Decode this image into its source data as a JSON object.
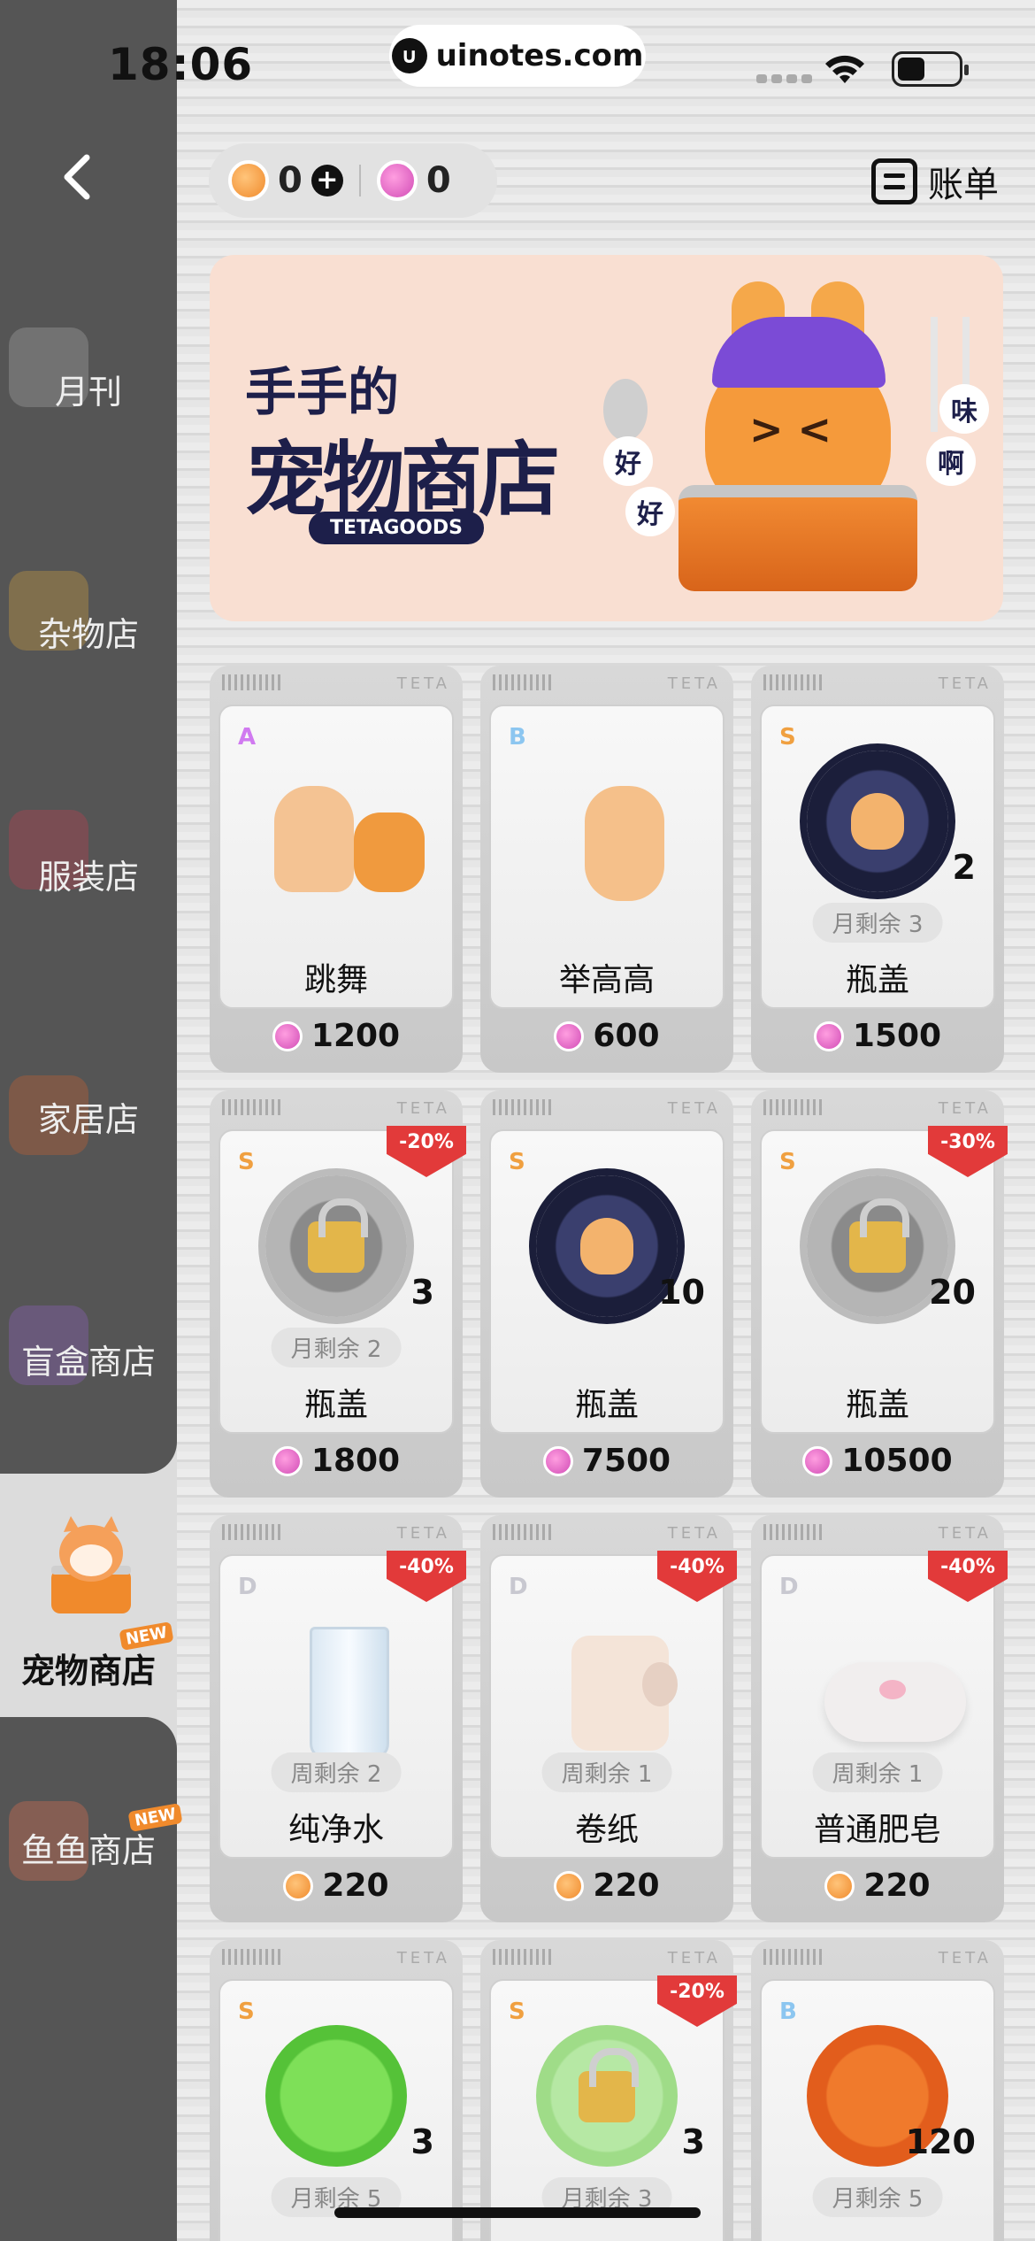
{
  "status_bar": {
    "time": "18:06",
    "url": "uinotes.com"
  },
  "header": {
    "coins": "0",
    "gems": "0",
    "bill_label": "账单"
  },
  "banner": {
    "title_line1": "手手的",
    "title_line2": "宠物商店",
    "brand": "TETAGOODS",
    "bubble_left_1": "好",
    "bubble_left_2": "好",
    "bubble_right_1": "味",
    "bubble_right_2": "啊"
  },
  "sidebar": {
    "items": [
      {
        "label": "月刊"
      },
      {
        "label": "杂物店"
      },
      {
        "label": "服装店"
      },
      {
        "label": "家居店"
      },
      {
        "label": "盲盒商店"
      },
      {
        "label": "宠物商店",
        "active": true,
        "badge": "NEW"
      },
      {
        "label": "鱼鱼商店",
        "badge": "NEW"
      }
    ]
  },
  "products": [
    {
      "grade": "A",
      "name": "跳舞",
      "price": "1200",
      "currency": "gem",
      "art": "dance"
    },
    {
      "grade": "B",
      "name": "举高高",
      "price": "600",
      "currency": "gem",
      "art": "lift"
    },
    {
      "grade": "S",
      "name": "瓶盖",
      "price": "1500",
      "currency": "gem",
      "art": "cap",
      "qty": "2",
      "limit": "月剩余 3"
    },
    {
      "grade": "S",
      "name": "瓶盖",
      "price": "1800",
      "currency": "gem",
      "art": "cap-locked",
      "qty": "3",
      "limit": "月剩余 2",
      "discount": "-20%"
    },
    {
      "grade": "S",
      "name": "瓶盖",
      "price": "7500",
      "currency": "gem",
      "art": "cap",
      "qty": "10"
    },
    {
      "grade": "S",
      "name": "瓶盖",
      "price": "10500",
      "currency": "gem",
      "art": "cap-locked",
      "qty": "20",
      "discount": "-30%"
    },
    {
      "grade": "D",
      "name": "纯净水",
      "price": "220",
      "currency": "coin",
      "art": "glass",
      "limit": "周剩余 2",
      "discount": "-40%"
    },
    {
      "grade": "D",
      "name": "卷纸",
      "price": "220",
      "currency": "coin",
      "art": "roll",
      "limit": "周剩余 1",
      "discount": "-40%"
    },
    {
      "grade": "D",
      "name": "普通肥皂",
      "price": "220",
      "currency": "coin",
      "art": "soap",
      "limit": "周剩余 1",
      "discount": "-40%"
    },
    {
      "grade": "S",
      "art": "clover",
      "qty": "3",
      "limit": "月剩余 5"
    },
    {
      "grade": "S",
      "art": "clover-locked",
      "qty": "3",
      "limit": "月剩余 3",
      "discount": "-20%"
    },
    {
      "grade": "B",
      "art": "gorgeous",
      "qty": "120",
      "limit": "月剩余 5"
    }
  ],
  "card_header_text": "TETA"
}
